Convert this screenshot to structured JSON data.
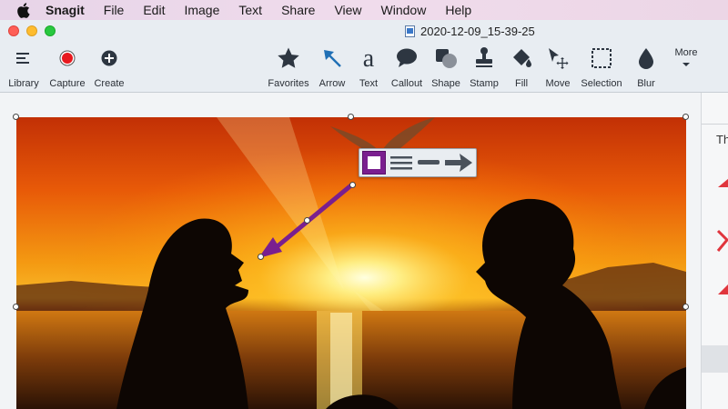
{
  "menubar": {
    "app_name": "Snagit",
    "items": [
      "File",
      "Edit",
      "Image",
      "Text",
      "Share",
      "View",
      "Window",
      "Help"
    ]
  },
  "window": {
    "title": "2020-12-09_15-39-25"
  },
  "toolbar": {
    "left": [
      {
        "label": "Library",
        "icon": "list-icon"
      },
      {
        "label": "Capture",
        "icon": "record-icon"
      },
      {
        "label": "Create",
        "icon": "plus-circle-icon"
      }
    ],
    "tools": [
      {
        "label": "Favorites",
        "icon": "star-icon"
      },
      {
        "label": "Arrow",
        "icon": "arrow-icon"
      },
      {
        "label": "Text",
        "icon": "text-icon"
      },
      {
        "label": "Callout",
        "icon": "callout-icon"
      },
      {
        "label": "Shape",
        "icon": "shape-icon"
      },
      {
        "label": "Stamp",
        "icon": "stamp-icon"
      },
      {
        "label": "Fill",
        "icon": "fill-icon"
      },
      {
        "label": "Move",
        "icon": "move-icon"
      },
      {
        "label": "Selection",
        "icon": "selection-icon"
      },
      {
        "label": "Blur",
        "icon": "blur-icon"
      }
    ],
    "more_label": "More"
  },
  "sidepanel": {
    "partial_text": "Th"
  },
  "colors": {
    "arrow": "#7a1f8f",
    "capture_red": "#e8191e",
    "toolbar_bg": "#e8edf2",
    "icon_dark": "#2d3641",
    "icon_blue": "#1f6fb5"
  }
}
